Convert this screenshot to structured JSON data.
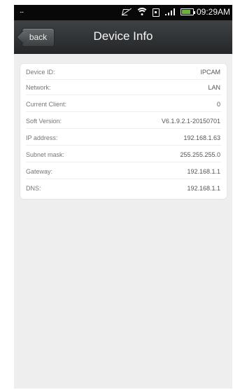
{
  "status_bar": {
    "dots_icon": "menu-dots-icon",
    "muted_icon": "muted-icon",
    "wifi_icon": "wifi-icon",
    "sim_icon": "sim-icon",
    "signal_icon": "signal-icon",
    "battery_icon": "battery-icon",
    "battery_level": 0.82,
    "time": "09:29AM",
    "dots": "..."
  },
  "navigation": {
    "back_label": "back",
    "title": "Device Info"
  },
  "device_info": {
    "rows": [
      {
        "label": "Device ID:",
        "value": "IPCAM"
      },
      {
        "label": "Network:",
        "value": "LAN"
      },
      {
        "label": "Current Client:",
        "value": "0"
      },
      {
        "label": "Soft Version:",
        "value": "V6.1.9.2.1-20150701"
      },
      {
        "label": "IP address:",
        "value": "192.168.1.63"
      },
      {
        "label": "Subnet mask:",
        "value": "255.255.255.0"
      },
      {
        "label": "Gateway:",
        "value": "192.168.1.1"
      },
      {
        "label": "DNS:",
        "value": "192.168.1.1"
      }
    ]
  },
  "colors": {
    "status_bar": "#080808",
    "nav_bar": "#2d3133",
    "screen_background": "#eeeeee",
    "card_background": "#ffffff",
    "battery_fill": "#69b33e"
  }
}
